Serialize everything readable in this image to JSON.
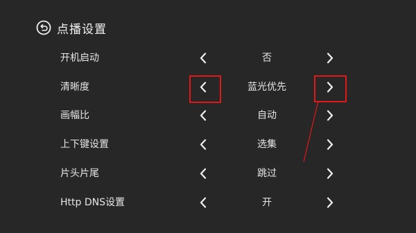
{
  "header": {
    "title": "点播设置",
    "back_icon": "back-arrow-circle-icon"
  },
  "settings": [
    {
      "label": "开机启动",
      "value": "否"
    },
    {
      "label": "清晰度",
      "value": "蓝光优先"
    },
    {
      "label": "画幅比",
      "value": "自动"
    },
    {
      "label": "上下键设置",
      "value": "选集"
    },
    {
      "label": "片头片尾",
      "value": "跳过"
    },
    {
      "label": "Http DNS设置",
      "value": "开"
    }
  ],
  "icons": {
    "prev": "chevron-left-icon",
    "next": "chevron-right-icon"
  },
  "colors": {
    "background": "#272727",
    "text": "#e6e6e6",
    "annotation": "#e01818"
  }
}
